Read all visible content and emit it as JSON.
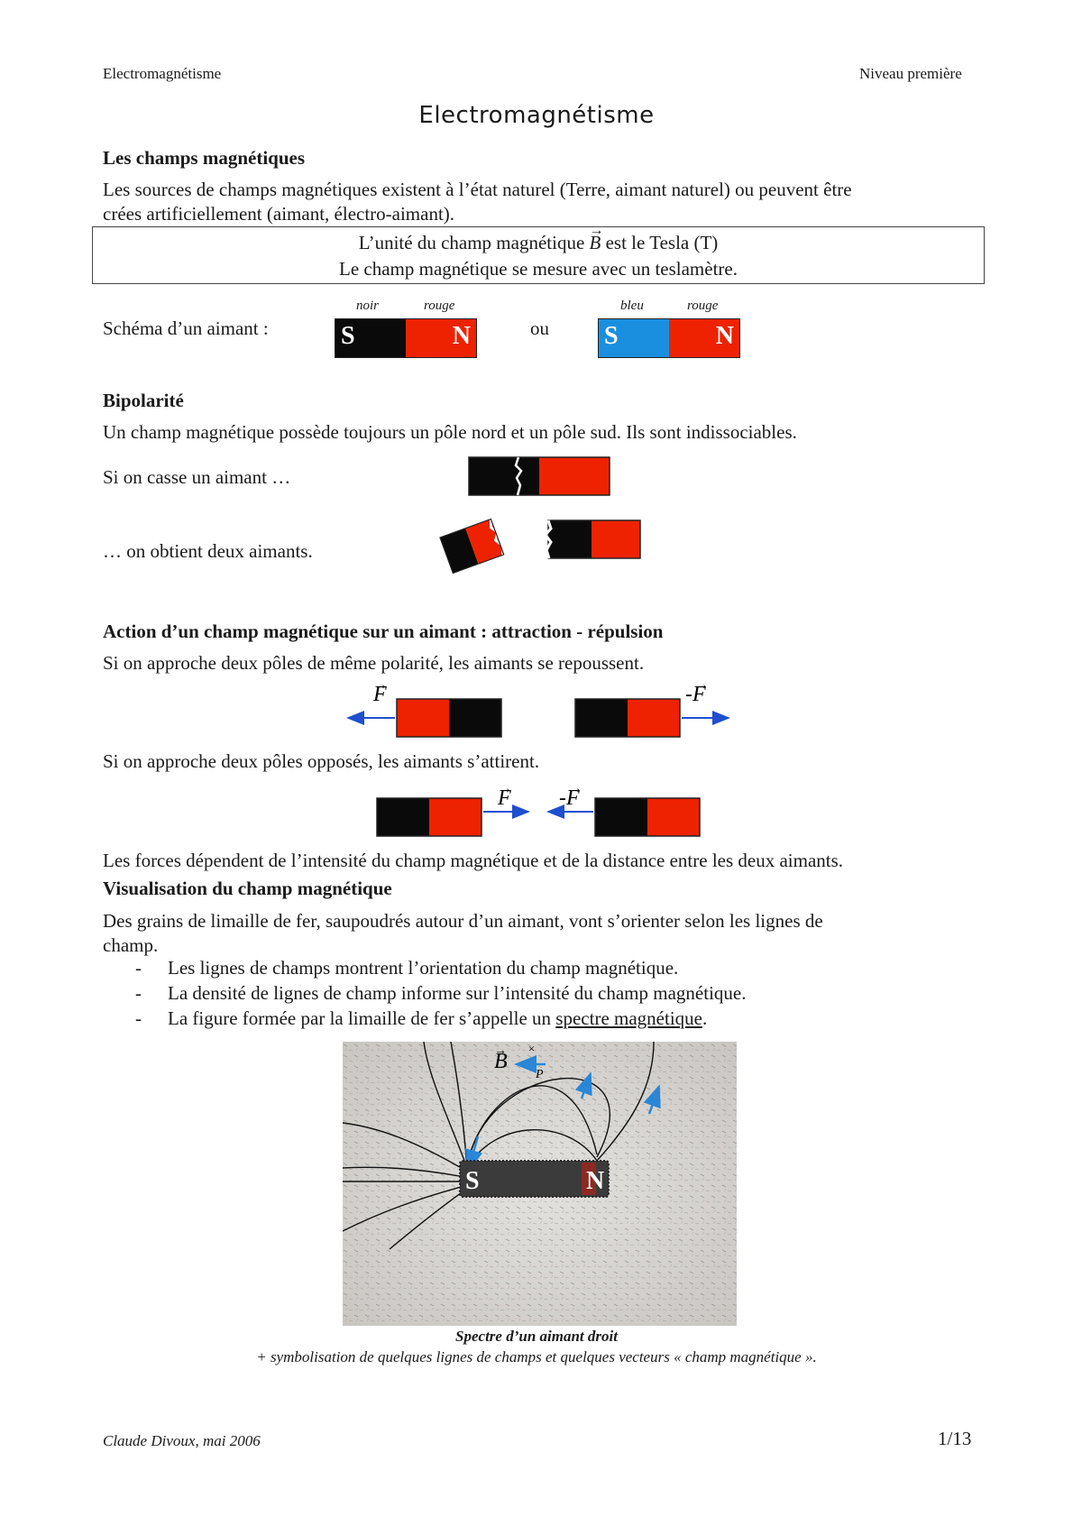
{
  "header": {
    "left": "Electromagnétisme",
    "right": "Niveau première"
  },
  "title": "Electromagnétisme",
  "sections": {
    "champs": {
      "heading": "Les champs magnétiques",
      "para_line1": "Les sources de champs magnétiques existent à l’état naturel (Terre, aimant naturel) ou peuvent être",
      "para_line2": "crées artificiellement (aimant, électro-aimant).",
      "box_line1_pre": "L’unité du champ magnétique",
      "box_line1_vec": "B",
      "box_line1_post": "est le Tesla (T)",
      "box_line2": "Le champ magnétique se mesure avec un teslamètre.",
      "schema_label": "Schéma d’un aimant :",
      "ou": "ou",
      "magnet1": {
        "left_color_label": "noir",
        "right_color_label": "rouge",
        "left_pole": "S",
        "right_pole": "N"
      },
      "magnet2": {
        "left_color_label": "bleu",
        "right_color_label": "rouge",
        "left_pole": "S",
        "right_pole": "N"
      }
    },
    "bipolarite": {
      "heading": "Bipolarité",
      "para": "Un champ magnétique possède toujours un pôle nord et un pôle sud. Ils sont indissociables.",
      "line1": "Si on casse un aimant …",
      "line2": "… on obtient deux aimants."
    },
    "action": {
      "heading": "Action d’un champ magnétique sur un aimant : attraction - répulsion",
      "repulsion": "Si on approche deux pôles de même polarité, les aimants se repoussent.",
      "attraction": "Si on approche deux pôles opposés, les aimants s’attirent.",
      "force_label": "F",
      "force_neg_label": "-F",
      "forces_note": "Les forces dépendent de l’intensité du champ magnétique et de la distance entre les deux aimants."
    },
    "visualisation": {
      "heading": "Visualisation du champ magnétique",
      "para_line1": "Des grains de limaille de fer, saupoudrés  autour d’un aimant, vont s’orienter selon les lignes de",
      "para_line2": "champ.",
      "bullets": [
        {
          "dash": "-",
          "text": "Les lignes de champs montrent l’orientation du champ magnétique."
        },
        {
          "dash": "-",
          "text": "La densité de lignes de champ informe sur l’intensité du champ magnétique."
        },
        {
          "dash": "-",
          "text_pre": "La figure formée par la limaille de fer s’appelle un ",
          "text_link": "spectre magnétique",
          "text_post": "."
        }
      ],
      "figure": {
        "vec_label": "B",
        "point_label": "P",
        "left_pole": "S",
        "right_pole": "N"
      },
      "caption1": "Spectre d’un aimant droit",
      "caption2": "+ symbolisation de quelques lignes de champs et quelques vecteurs « champ magnétique »."
    }
  },
  "footer": {
    "left": "Claude Divoux, mai 2006",
    "right": "1/13"
  },
  "colors": {
    "red": "#ee2200",
    "black": "#0a0a0a",
    "blue": "#1a8fe0",
    "arrow_blue": "#1f4fcf"
  }
}
